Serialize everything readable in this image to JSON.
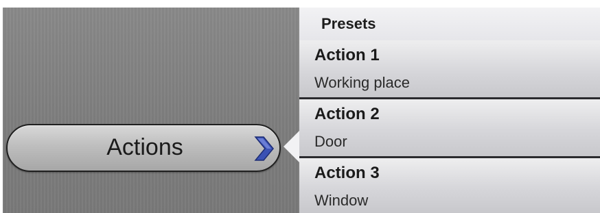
{
  "actions_button": {
    "label": "Actions",
    "chevron_icon": "chevron-right-icon",
    "chevron_color": "#3b52b4"
  },
  "presets": {
    "header": "Presets",
    "items": [
      {
        "title": "Action 1",
        "subtitle": "Working place"
      },
      {
        "title": "Action 2",
        "subtitle": "Door"
      },
      {
        "title": "Action 3",
        "subtitle": "Window"
      }
    ]
  }
}
